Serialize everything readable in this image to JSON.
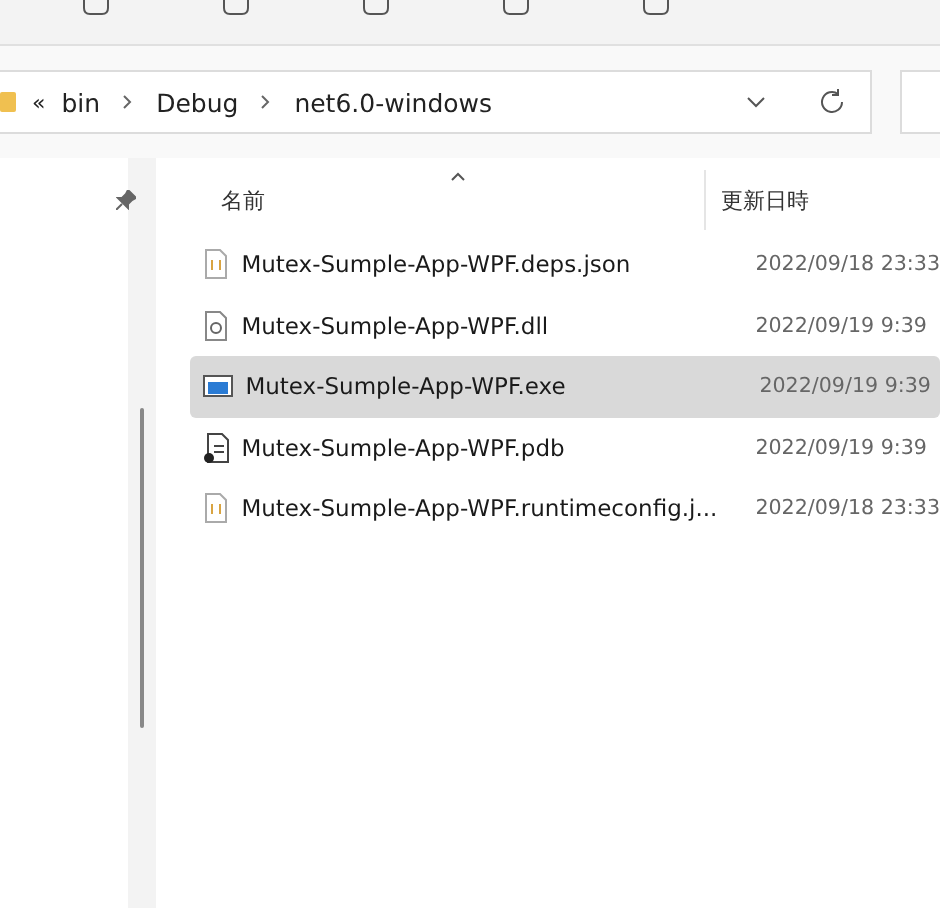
{
  "address_bar": {
    "overflow": "«",
    "crumbs": [
      "bin",
      "Debug",
      "net6.0-windows"
    ]
  },
  "columns": [
    {
      "label": "名前",
      "sorted": true
    },
    {
      "label": "更新日時",
      "sorted": false
    }
  ],
  "files": [
    {
      "name": "Mutex-Sumple-App-WPF.deps.json",
      "modified": "2022/09/18 23:33",
      "kind": "json",
      "selected": false
    },
    {
      "name": "Mutex-Sumple-App-WPF.dll",
      "modified": "2022/09/19 9:39",
      "kind": "dll",
      "selected": false
    },
    {
      "name": "Mutex-Sumple-App-WPF.exe",
      "modified": "2022/09/19 9:39",
      "kind": "exe",
      "selected": true
    },
    {
      "name": "Mutex-Sumple-App-WPF.pdb",
      "modified": "2022/09/19 9:39",
      "kind": "pdb",
      "selected": false
    },
    {
      "name": "Mutex-Sumple-App-WPF.runtimeconfig.j...",
      "modified": "2022/09/18 23:33",
      "kind": "json",
      "selected": false
    }
  ]
}
